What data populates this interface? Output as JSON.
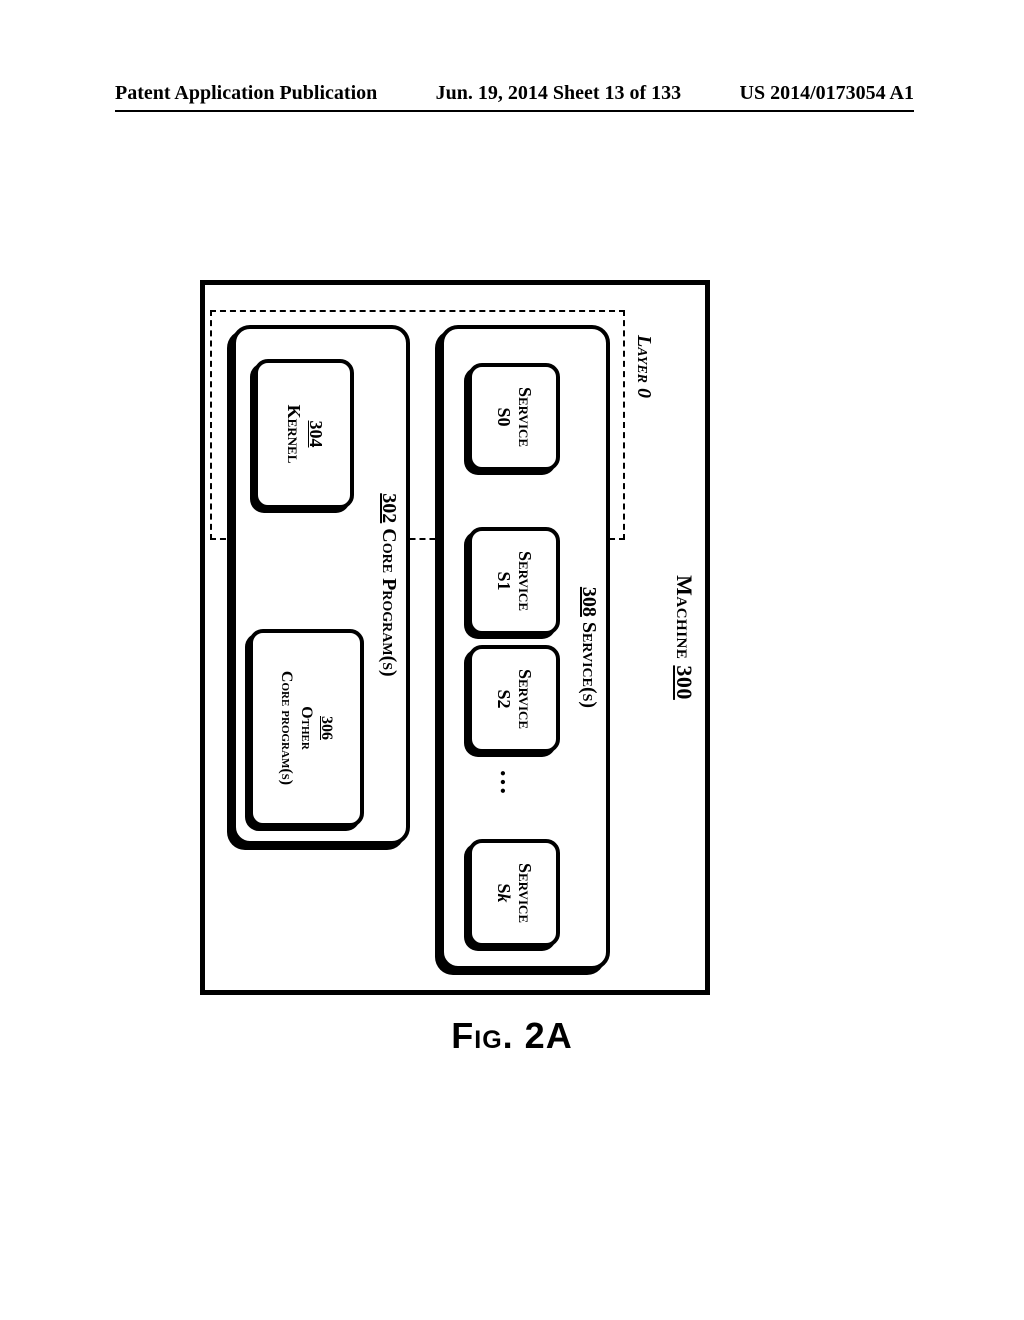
{
  "header": {
    "left": "Patent Application Publication",
    "center": "Jun. 19, 2014  Sheet 13 of 133",
    "right": "US 2014/0173054 A1"
  },
  "figure": {
    "caption": "Fig. 2A",
    "machine": {
      "label": "Machine",
      "ref": "300"
    },
    "layer0_label": "Layer 0",
    "services": {
      "ref": "308",
      "label": "Service(s)",
      "items": [
        {
          "label": "Service",
          "id": "S0"
        },
        {
          "label": "Service",
          "id": "S1"
        },
        {
          "label": "Service",
          "id": "S2"
        },
        {
          "label": "Service",
          "id": "Sk",
          "italic_index": true
        }
      ],
      "ellipsis": "…"
    },
    "core": {
      "ref": "302",
      "label": "Core Program(s)",
      "kernel": {
        "ref": "304",
        "label": "Kernel"
      },
      "other": {
        "ref": "306",
        "label_line1": "Other",
        "label_line2": "Core program(s)"
      }
    }
  }
}
